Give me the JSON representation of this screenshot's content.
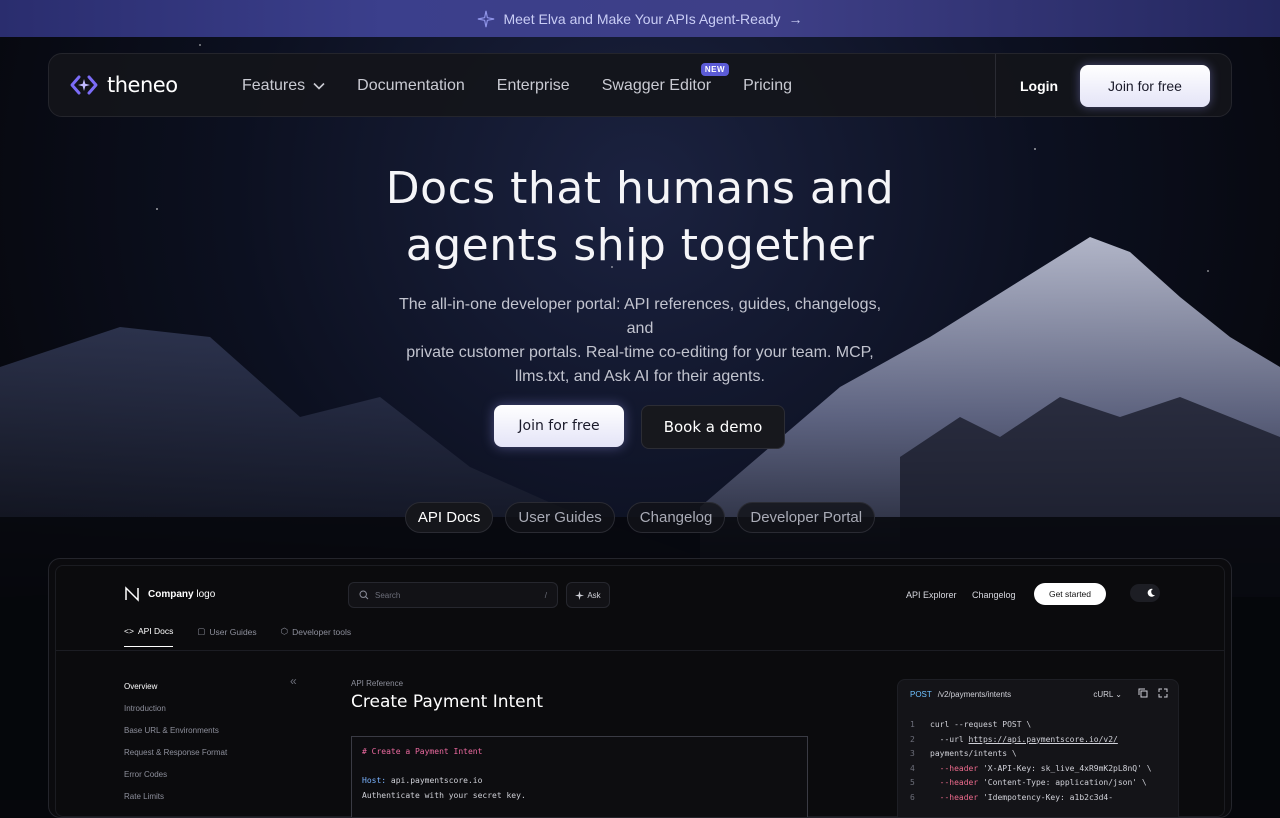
{
  "announcement": {
    "text": "Meet Elva and Make Your APIs Agent-Ready",
    "arrow": "→"
  },
  "nav": {
    "logo": "theneo",
    "items": [
      {
        "label": "Features",
        "has_dropdown": true
      },
      {
        "label": "Documentation"
      },
      {
        "label": "Enterprise"
      },
      {
        "label": "Swagger Editor",
        "badge": "NEW"
      },
      {
        "label": "Pricing"
      }
    ],
    "login": "Login",
    "join": "Join for free"
  },
  "hero": {
    "headline_line1": "Docs that humans and",
    "headline_line2": "agents ship together",
    "sub_line1": "The all-in-one developer portal: API references, guides, changelogs, and",
    "sub_line2": "private customer portals. Real-time co-editing for your team. MCP,",
    "sub_line3": "llms.txt, and Ask AI for their agents.",
    "cta_primary": "Join for free",
    "cta_secondary": "Book a demo"
  },
  "pills": [
    "API Docs",
    "User Guides",
    "Changelog",
    "Developer Portal"
  ],
  "preview": {
    "company_bold": "Company",
    "company_rest": "logo",
    "search_placeholder": "Search",
    "search_shortcut": "/",
    "ask": "Ask",
    "top_links": [
      "API Explorer",
      "Changelog"
    ],
    "get_started": "Get started",
    "tabs": [
      "API Docs",
      "User Guides",
      "Developer tools"
    ],
    "sidebar": [
      "Overview",
      "Introduction",
      "Base URL & Environments",
      "Request & Response Format",
      "Error Codes",
      "Rate Limits"
    ],
    "breadcrumb": "API Reference",
    "title": "Create Payment Intent",
    "code": {
      "comment": "# Create a Payment Intent",
      "host_key": "Host:",
      "host_val": "api.paymentscore.io",
      "auth": "Authenticate with your secret key."
    },
    "curl": {
      "method": "POST",
      "path": "/v2/payments/intents",
      "lang": "cURL",
      "lines": [
        {
          "n": "1",
          "a": "curl --request POST \\"
        },
        {
          "n": "2",
          "a": "  --url ",
          "u": "https://api.paymentscore.io/v2/"
        },
        {
          "n": "3",
          "a": "payments/intents \\"
        },
        {
          "n": "4",
          "k": "  --header",
          "a": " 'X-API-Key: sk_live_4xR9mK2pL8nQ' \\"
        },
        {
          "n": "5",
          "k": "  --header",
          "a": " 'Content-Type: application/json' \\"
        },
        {
          "n": "6",
          "k": "  --header",
          "a": " 'Idempotency-Key: a1b2c3d4-"
        }
      ]
    }
  },
  "colors": {
    "accent": "#5b5bd6",
    "background": "#06070c",
    "comment": "#ec6aa0",
    "method": "#6ec1ff"
  }
}
